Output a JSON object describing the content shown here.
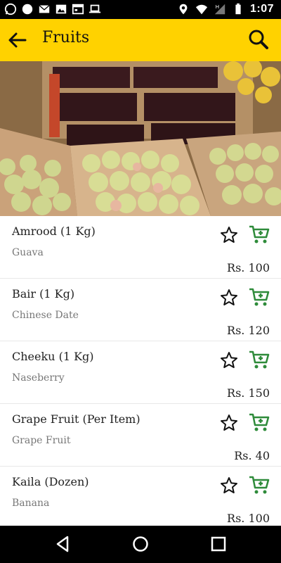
{
  "status_bar": {
    "time": "1:07",
    "icons": [
      "whatsapp-icon",
      "circle-icon",
      "mail-icon",
      "image-icon",
      "calendar-icon",
      "laptop-icon",
      "location-icon",
      "wifi-icon",
      "network-icon",
      "battery-icon"
    ]
  },
  "app_bar": {
    "title": "Fruits",
    "background": "#FFD200",
    "icons": [
      "back-arrow-icon",
      "search-icon"
    ]
  },
  "items": [
    {
      "name": "Amrood (1 Kg)",
      "subtitle": "Guava",
      "price": "Rs. 100"
    },
    {
      "name": "Bair (1 Kg)",
      "subtitle": "Chinese Date",
      "price": "Rs. 120"
    },
    {
      "name": "Cheeku (1 Kg)",
      "subtitle": "Naseberry",
      "price": "Rs. 150"
    },
    {
      "name": "Grape Fruit (Per Item)",
      "subtitle": "Grape Fruit",
      "price": "Rs. 40"
    },
    {
      "name": "Kaila (Dozen)",
      "subtitle": "Banana",
      "price": "Rs. 100"
    }
  ],
  "item_icons": [
    "star-outline-icon",
    "cart-icon"
  ],
  "cart_color": "#2E8B3A",
  "nav_bar": {
    "icons": [
      "back-triangle-icon",
      "home-circle-icon",
      "recents-square-icon"
    ]
  }
}
